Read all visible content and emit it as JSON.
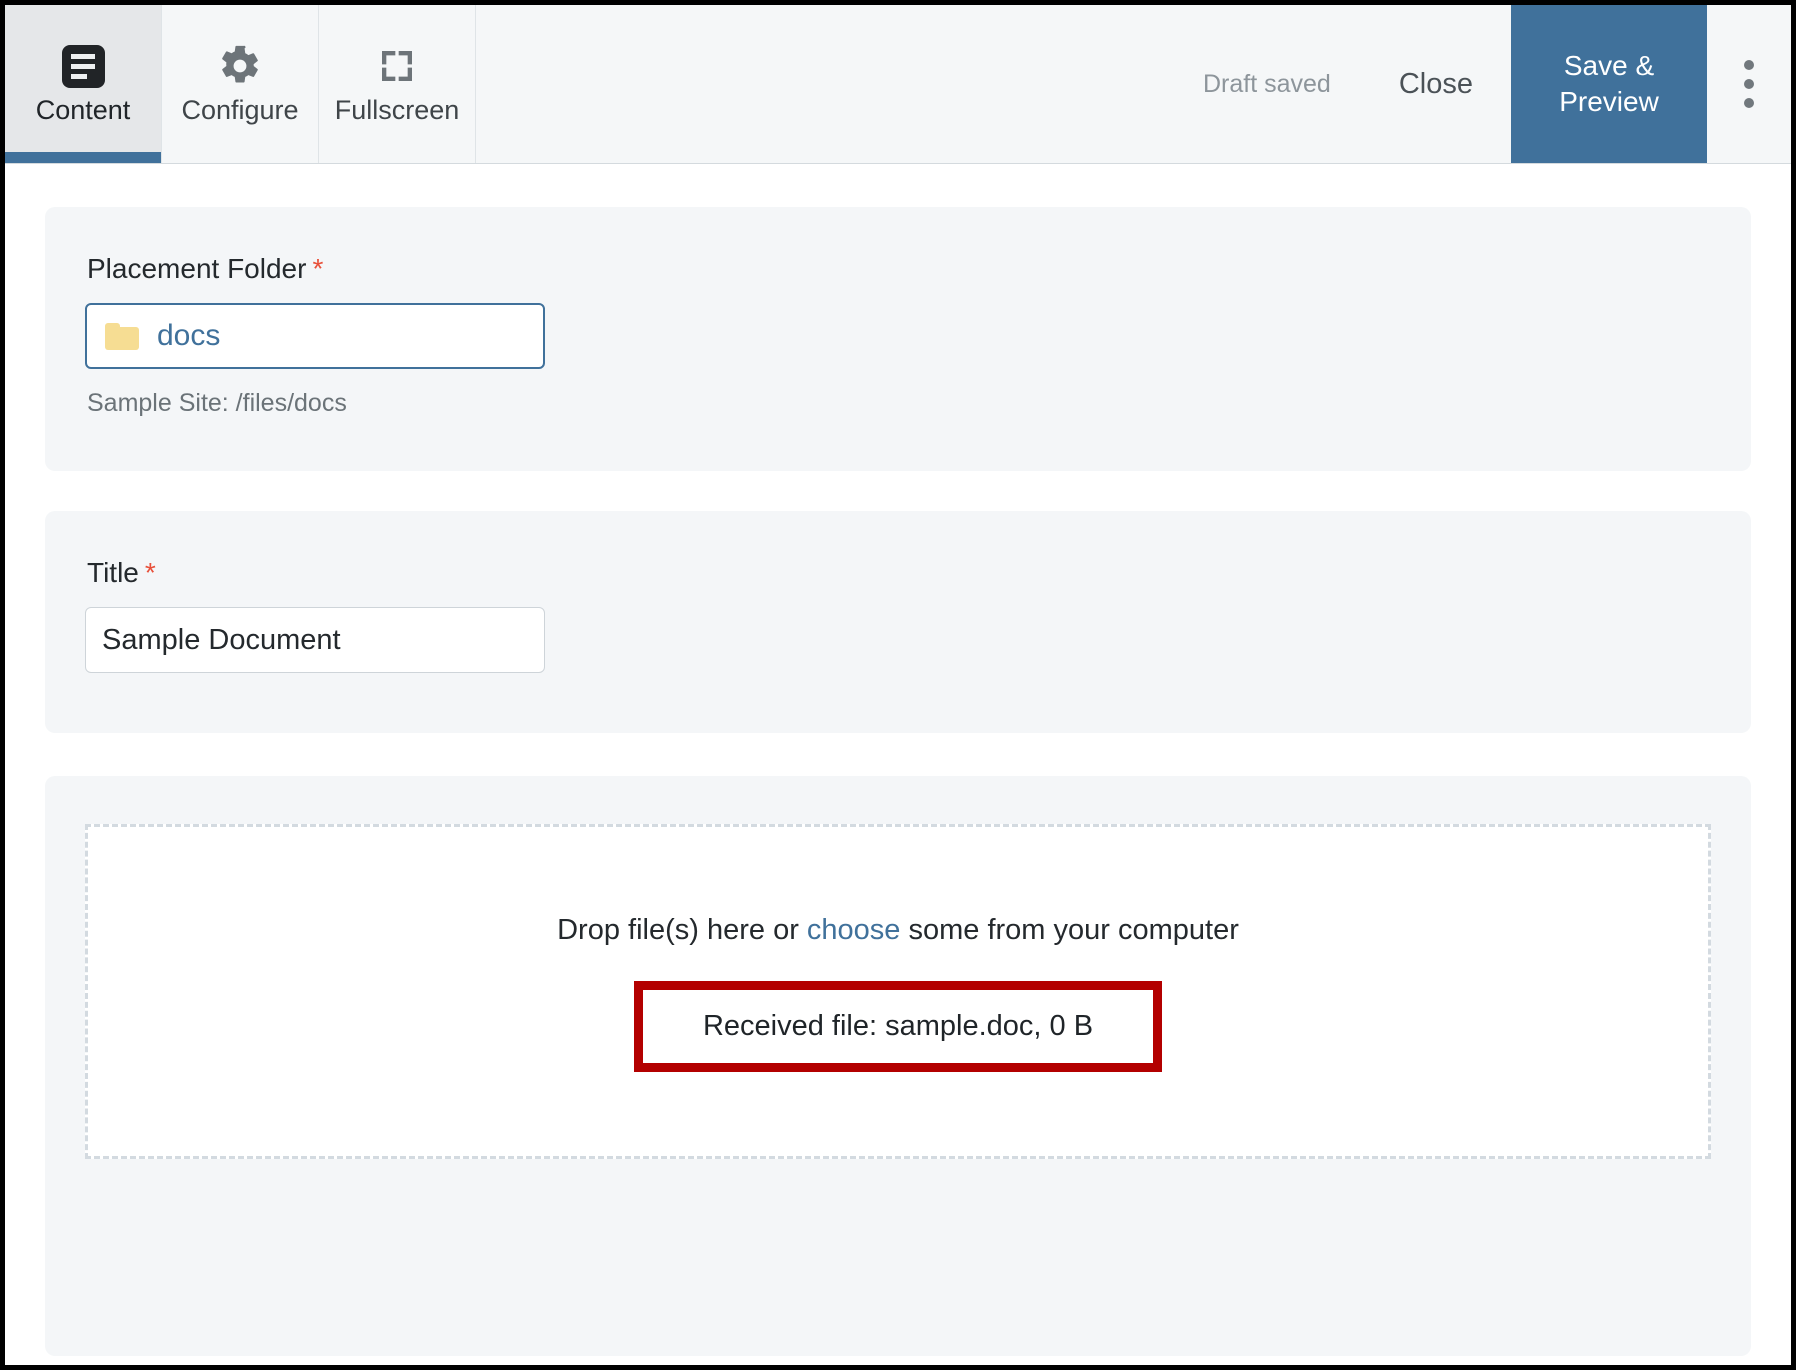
{
  "toolbar": {
    "tabs": [
      {
        "label": "Content",
        "icon": "document-lines-icon",
        "active": true
      },
      {
        "label": "Configure",
        "icon": "gear-icon",
        "active": false
      },
      {
        "label": "Fullscreen",
        "icon": "fullscreen-icon",
        "active": false
      }
    ],
    "draft_status": "Draft saved",
    "close_label": "Close",
    "save_label": "Save & Preview",
    "overflow_icon": "vertical-dots-icon",
    "accent_color": "#40719b"
  },
  "form": {
    "placement_folder": {
      "label": "Placement Folder",
      "required_marker": "*",
      "value": "docs",
      "icon": "folder-icon",
      "helper": "Sample Site: /files/docs"
    },
    "title": {
      "label": "Title",
      "required_marker": "*",
      "value": "Sample Document",
      "placeholder": ""
    },
    "upload": {
      "drop_text_before": "Drop file(s) here or ",
      "drop_link": "choose",
      "drop_text_after": " some from your computer",
      "received_file": "Received file: sample.doc, 0 B",
      "highlight_color": "#b30000"
    }
  }
}
